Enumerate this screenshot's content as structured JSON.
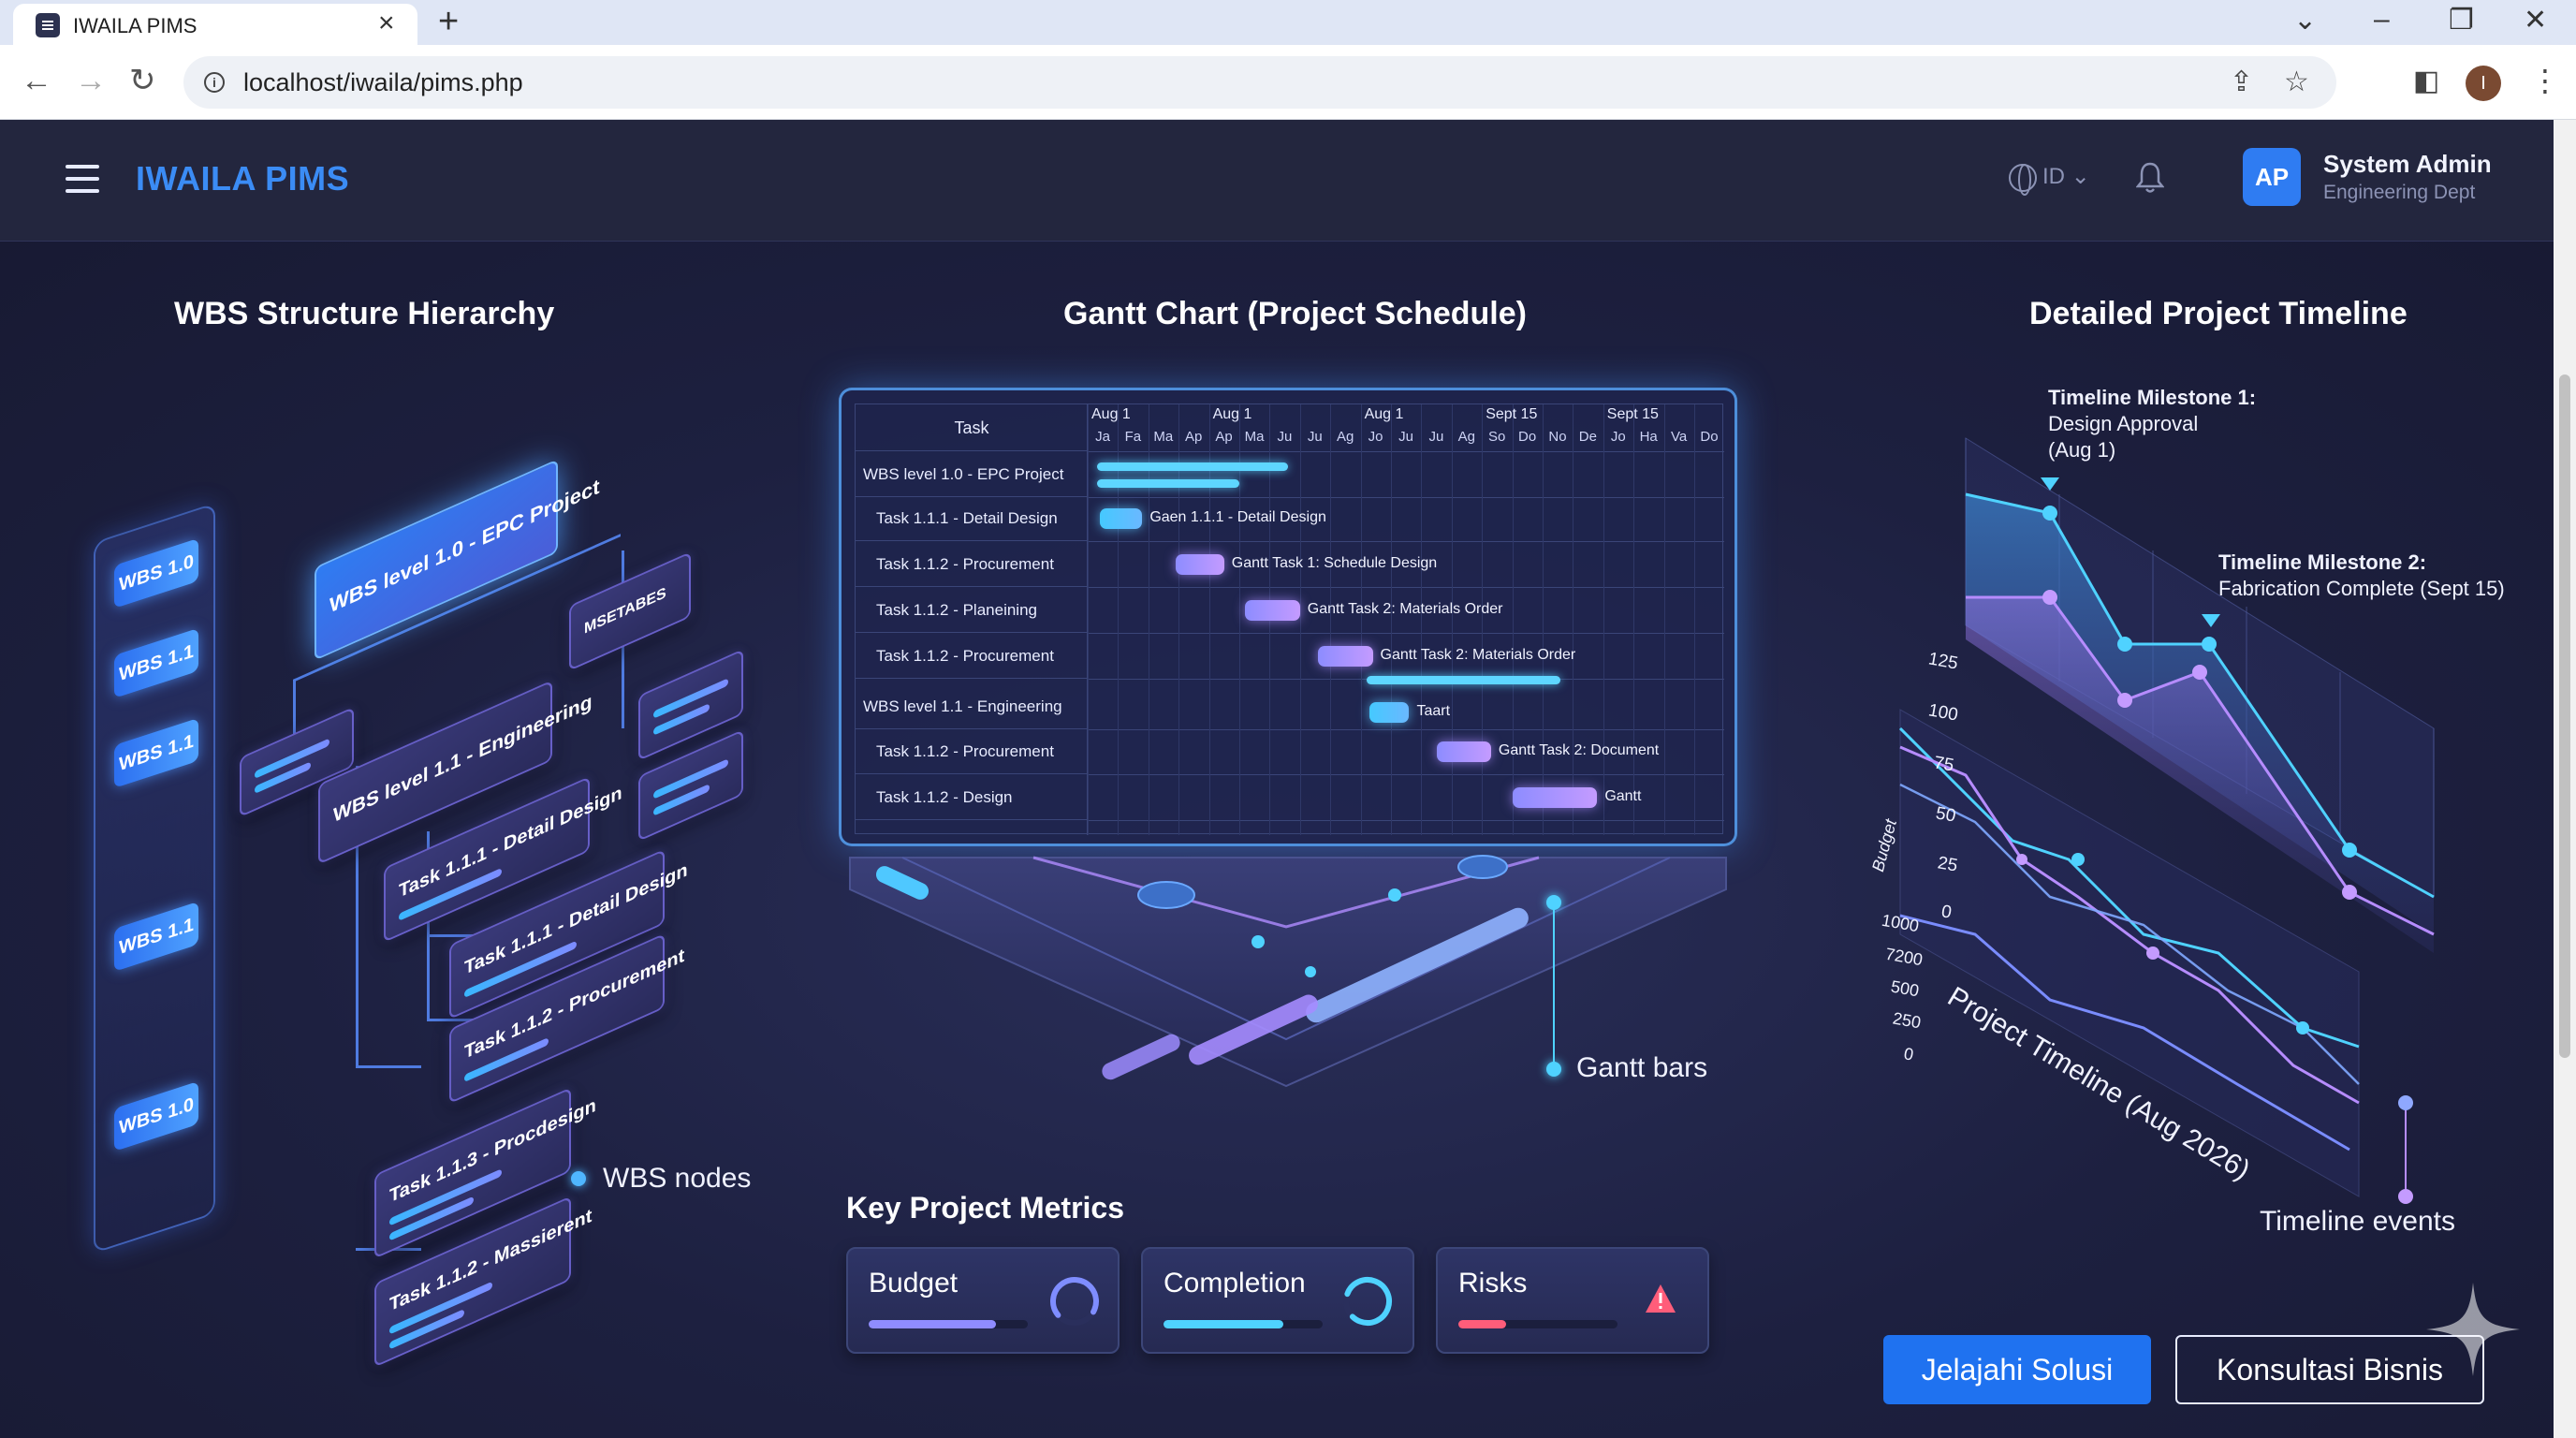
{
  "browser": {
    "tab_title": "IWAILA PIMS",
    "url": "localhost/iwaila/pims.php",
    "profile_initial": "I"
  },
  "header": {
    "brand": "IWAILA PIMS",
    "language": "ID",
    "user_initials": "AP",
    "user_name": "System Admin",
    "user_dept": "Engineering Dept"
  },
  "wbs": {
    "title": "WBS Structure Hierarchy",
    "column_pills": [
      "WBS 1.0",
      "WBS 1.1",
      "WBS 1.1",
      "WBS 1.1",
      "WBS 1.0"
    ],
    "root": "WBS level 1.0 - EPC Project",
    "side_node": "MSETABES",
    "engineering": "WBS level 1.1 - Engineering",
    "tasks": [
      "Task 1.1.1 - Detail Design",
      "Task 1.1.1 - Detail Design",
      "Task 1.1.2 - Procurement",
      "Task 1.1.3 - Procdesign",
      "Task 1.1.2 - Massierent"
    ],
    "legend": "WBS nodes"
  },
  "gantt": {
    "title": "Gantt Chart (Project Schedule)",
    "task_header": "Task",
    "months": [
      "Aug 1",
      "Aug 1",
      "Aug 1",
      "Sept 15",
      "Sept 15"
    ],
    "days": [
      "Ja",
      "Fa",
      "Ma",
      "Ap",
      "Ap",
      "Ma",
      "Ju",
      "Ju",
      "Ag",
      "Jo",
      "Ju",
      "Ju",
      "Ag",
      "So",
      "Do",
      "No",
      "De",
      "Jo",
      "Ha",
      "Va",
      "Do"
    ],
    "rows": [
      {
        "label": "WBS level 1.0 - EPC Project",
        "bar_label": ""
      },
      {
        "label": "Task 1.1.1 - Detail Design",
        "bar_label": "Gaen 1.1.1 - Detail Design"
      },
      {
        "label": "Task 1.1.2 - Procurement",
        "bar_label": "Gantt Task 1: Schedule Design"
      },
      {
        "label": "Task 1.1.2 - Planeining",
        "bar_label": "Gantt Task 2: Materials Order"
      },
      {
        "label": "Task 1.1.2 - Procurement",
        "bar_label": "Gantt Task 2: Materials Order"
      },
      {
        "label": "WBS level 1.1 - Engineering",
        "bar_label": "Taart"
      },
      {
        "label": "Task 1.1.2 - Procurement",
        "bar_label": "Gantt Task 2: Document"
      },
      {
        "label": "Task 1.1.2 - Design",
        "bar_label": "Gantt"
      }
    ],
    "legend": "Gantt bars"
  },
  "metrics": {
    "title": "Key Project Metrics",
    "items": [
      {
        "label": "Budget",
        "progress": 0.8,
        "color": "#8f8cff",
        "indicator": "ring-icon"
      },
      {
        "label": "Completion",
        "progress": 0.75,
        "color": "#4fd2ff",
        "indicator": "ring-icon"
      },
      {
        "label": "Risks",
        "progress": 0.3,
        "color": "#ff5d7a",
        "indicator": "warning-icon"
      }
    ]
  },
  "timeline": {
    "title": "Detailed Project Timeline",
    "milestone1_title": "Timeline Milestone 1:",
    "milestone1_l1": "Design Approval",
    "milestone1_l2": "(Aug 1)",
    "milestone2_title": "Timeline Milestone 2:",
    "milestone2_l1": "Fabrication Complete (Sept 15)",
    "upper_ticks": [
      "125",
      "100",
      "75",
      "50",
      "25",
      "0"
    ],
    "lower_ticks": [
      "1000",
      "7200",
      "500",
      "250",
      "0"
    ],
    "budget_label": "Budget",
    "axis_label": "Project Timeline (Aug 2026)",
    "legend": "Timeline events"
  },
  "cta": {
    "primary": "Jelajahi Solusi",
    "secondary": "Konsultasi Bisnis"
  },
  "colors": {
    "accent": "#1f72f0",
    "cyan": "#4fd2ff",
    "purple": "#a98cff",
    "risk": "#ff5d7a"
  }
}
